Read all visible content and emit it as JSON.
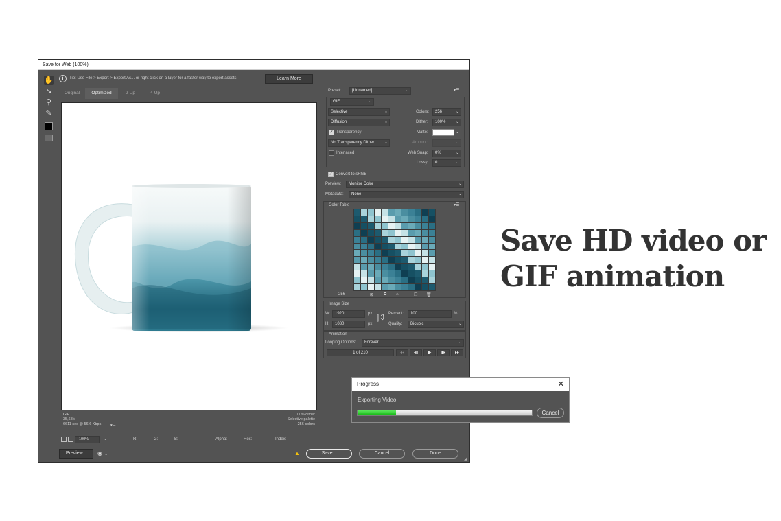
{
  "window": {
    "title": "Save for Web (100%)",
    "tip": "Tip: Use File > Export > Export As...  or right click on a layer for a faster way to export assets",
    "learn_more": "Learn More"
  },
  "tabs": [
    "Original",
    "Optimized",
    "2-Up",
    "4-Up"
  ],
  "active_tab": "Optimized",
  "canvas_info": {
    "format": "GIF",
    "size": "35,68M",
    "time": "6611 sec @ 56.6 Kbps",
    "dither": "100% dither",
    "palette": "Selective palette",
    "colors": "256 colors"
  },
  "bottom_info": {
    "zoom": "100%",
    "r": "R: --",
    "g": "G: --",
    "b": "B: --",
    "alpha": "Alpha: --",
    "hex": "Hex: --",
    "index": "Index: --"
  },
  "footer": {
    "preview": "Preview...",
    "save": "Save...",
    "cancel": "Cancel",
    "done": "Done"
  },
  "settings": {
    "preset_label": "Preset:",
    "preset_value": "[Unnamed]",
    "format": "GIF",
    "reduction": "Selective",
    "dither_algo": "Diffusion",
    "transparency_label": "Transparency",
    "transparency_dither": "No Transparency Dither",
    "interlaced_label": "Interlaced",
    "colors_label": "Colors:",
    "colors_value": "256",
    "dither_label": "Dither:",
    "dither_value": "100%",
    "matte_label": "Matte:",
    "amount_label": "Amount:",
    "websnap_label": "Web Snap:",
    "websnap_value": "0%",
    "lossy_label": "Lossy:",
    "lossy_value": "0",
    "convert_srgb": "Convert to sRGB",
    "preview_label": "Preview:",
    "preview_value": "Monitor Color",
    "metadata_label": "Metadata:",
    "metadata_value": "None"
  },
  "color_table": {
    "title": "Color Table",
    "count": "256",
    "palette": [
      "#1d5a6e",
      "#4a8ea0",
      "#8fc4cf",
      "#2a6f84",
      "#c6e2e6",
      "#165063",
      "#6aaab8",
      "#a9d3db",
      "#3b8196",
      "#e6f2f3",
      "#0f3f52",
      "#5a9cad"
    ]
  },
  "image_size": {
    "title": "Image Size",
    "w_label": "W:",
    "w_value": "1920",
    "h_label": "H:",
    "h_value": "1080",
    "unit": "px",
    "percent_label": "Percent:",
    "percent_value": "100",
    "percent_unit": "%",
    "quality_label": "Quality:",
    "quality_value": "Bicubic"
  },
  "animation": {
    "title": "Animation",
    "looping_label": "Looping Options:",
    "looping_value": "Forever",
    "frame": "1 of 210"
  },
  "progress": {
    "title": "Progress",
    "status": "Exporting Video",
    "cancel": "Cancel",
    "fraction": 0.22
  },
  "headline": {
    "line1": "Save HD video or",
    "line2": "GIF animation"
  },
  "colors": {
    "panel_bg": "#535353",
    "progress_green": "#16b816",
    "headline": "#333333",
    "warning": "#f4c20d"
  }
}
